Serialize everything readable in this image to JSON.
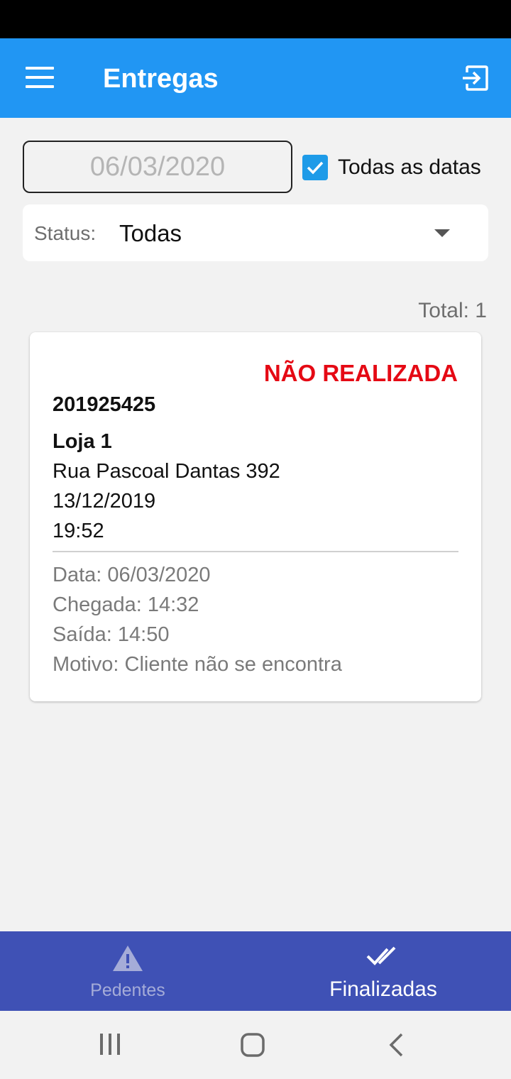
{
  "app_bar": {
    "title": "Entregas",
    "background_color": "#2196f3",
    "menu_icon": "hamburger-menu-icon",
    "logout_icon": "logout-icon"
  },
  "filters": {
    "date_value": "06/03/2020",
    "all_dates_label": "Todas as datas",
    "all_dates_checked": true,
    "status_label": "Status:",
    "status_value": "Todas"
  },
  "total_label": "Total: 1",
  "deliveries": [
    {
      "status": "NÃO REALIZADA",
      "status_color": "#e50914",
      "id": "201925425",
      "store": "Loja 1",
      "address": "Rua Pascoal Dantas 392",
      "date": "13/12/2019",
      "time": "19:52",
      "info_date": "Data: 06/03/2020",
      "arrival": "Chegada: 14:32",
      "departure": "Saída: 14:50",
      "reason": "Motivo: Cliente não se encontra"
    }
  ],
  "bottom_nav": {
    "background_color": "#3f51b5",
    "tabs": [
      {
        "label": "Pedentes",
        "icon": "warning-icon",
        "active": false
      },
      {
        "label": "Finalizadas",
        "icon": "double-check-icon",
        "active": true
      }
    ]
  },
  "system_nav": {
    "buttons": [
      "recent-apps-icon",
      "home-icon",
      "back-icon"
    ]
  }
}
